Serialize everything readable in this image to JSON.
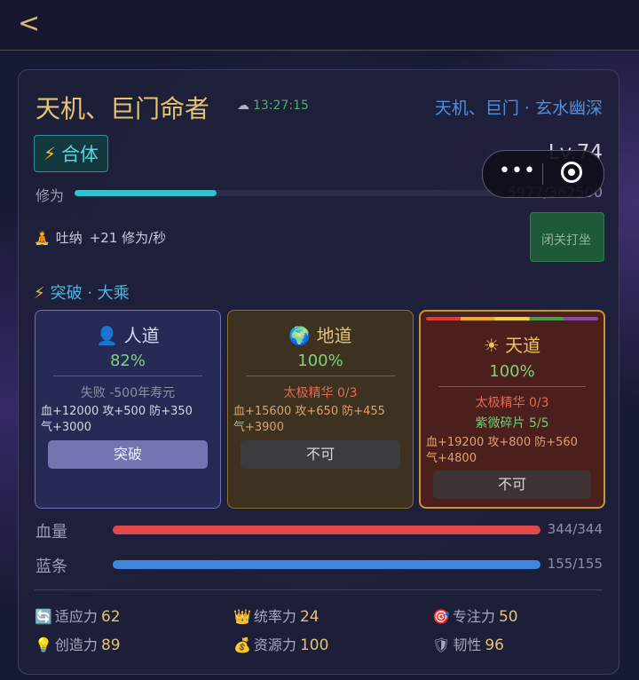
{
  "header": {
    "back_label": "<"
  },
  "character": {
    "title": "天机、巨门命者",
    "time": "13:27:15",
    "subtitle": "天机、巨门 · 玄水幽深",
    "realm": "合体",
    "level": "Lv.74",
    "xp_label": "修为",
    "xp_text": "5977/362500",
    "xp_fraction": 0.33,
    "tuna_label": "吐纳",
    "tuna_value": "+21 修为/秒",
    "retreat_label": "闭关打坐"
  },
  "breakthrough": {
    "label": "突破 · 大乘",
    "paths": [
      {
        "icon": "👤",
        "name": "人道",
        "percent": "82%",
        "lines": [
          "失败 -500年寿元"
        ],
        "bonus1": "血+12000 攻+500 防+350",
        "bonus2": "气+3000",
        "button": "突破"
      },
      {
        "icon": "🌍",
        "name": "地道",
        "percent": "100%",
        "lines": [
          "太极精华 0/3"
        ],
        "bonus1": "血+15600 攻+650 防+455",
        "bonus2": "气+3900",
        "button": "不可"
      },
      {
        "icon": "☀",
        "name": "天道",
        "percent": "100%",
        "lines": [
          "太极精华 0/3",
          "紫微碎片 5/5"
        ],
        "bonus1": "血+19200 攻+800 防+560",
        "bonus2": "气+4800",
        "button": "不可"
      }
    ]
  },
  "bars": {
    "hp_label": "血量",
    "hp_text": "344/344",
    "hp_fraction": 1.0,
    "mp_label": "蓝条",
    "mp_text": "155/155",
    "mp_fraction": 1.0
  },
  "stats": [
    {
      "icon": "🔄",
      "label": "适应力",
      "value": "62"
    },
    {
      "icon": "👑",
      "label": "统率力",
      "value": "24"
    },
    {
      "icon": "🎯",
      "label": "专注力",
      "value": "50"
    },
    {
      "icon": "💡",
      "label": "创造力",
      "value": "89"
    },
    {
      "icon": "💰",
      "label": "资源力",
      "value": "100"
    },
    {
      "icon": "🛡",
      "label": "韧性",
      "value": "96"
    }
  ],
  "capsule": {
    "more_icon": "more-dots-icon",
    "close_icon": "target-close-icon"
  },
  "colors": {
    "accent_gold": "#e7c374",
    "accent_blue": "#4f8fe0",
    "hp": "#e0484a",
    "mp": "#3f85dc",
    "xp": "#35c0c9"
  }
}
